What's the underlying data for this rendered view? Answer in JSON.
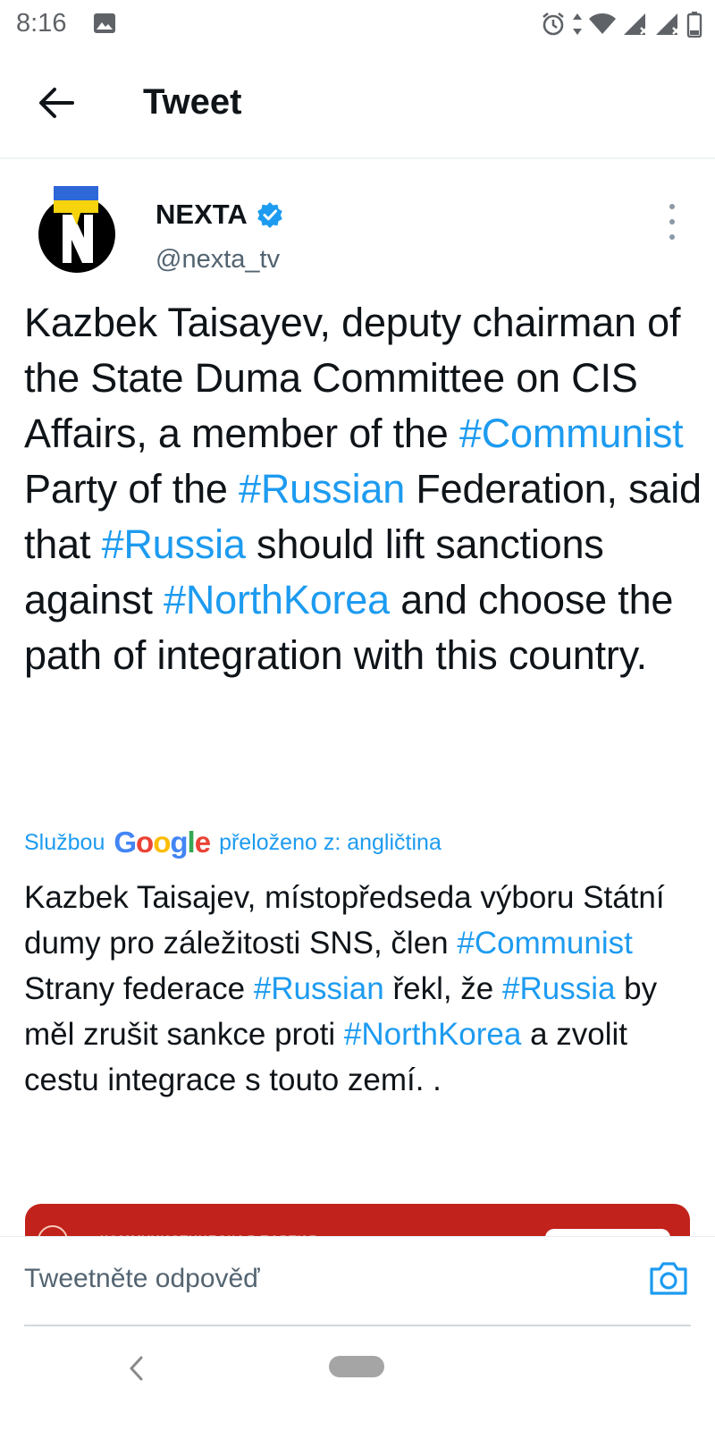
{
  "status_bar": {
    "time": "8:16"
  },
  "header": {
    "title": "Tweet"
  },
  "author": {
    "name": "NEXTA",
    "handle": "@nexta_tv",
    "avatar_letter": "N",
    "verified": true
  },
  "tweet": {
    "segments": [
      {
        "text": "Kazbek Taisayev, deputy chairman of the State Duma Committee on CIS Affairs, a member of the ",
        "hashtag": false
      },
      {
        "text": "#Communist",
        "hashtag": true
      },
      {
        "text": " Party of the ",
        "hashtag": false
      },
      {
        "text": "#Russian",
        "hashtag": true
      },
      {
        "text": " Federation, said that ",
        "hashtag": false
      },
      {
        "text": "#Russia",
        "hashtag": true
      },
      {
        "text": " should lift sanctions against ",
        "hashtag": false
      },
      {
        "text": "#NorthKorea",
        "hashtag": true
      },
      {
        "text": " and choose the path of integration with this country.",
        "hashtag": false
      }
    ]
  },
  "translation": {
    "prefix": "Službou",
    "provider": "Google",
    "suffix": "přeloženo z: angličtina",
    "segments": [
      {
        "text": "Kazbek Taisajev, místopředseda výboru Státní dumy pro záležitosti SNS, člen ",
        "hashtag": false
      },
      {
        "text": "#Communist",
        "hashtag": true
      },
      {
        "text": " Strany federace ",
        "hashtag": false
      },
      {
        "text": "#Russian",
        "hashtag": true
      },
      {
        "text": " řekl, že ",
        "hashtag": false
      },
      {
        "text": "#Russia",
        "hashtag": true
      },
      {
        "text": " by měl zrušit sankce proti ",
        "hashtag": false
      },
      {
        "text": "#NorthKorea",
        "hashtag": true
      },
      {
        "text": " a zvolit cestu integrace s touto zemí. .",
        "hashtag": false
      }
    ]
  },
  "media_card": {
    "label": "КОММУНИСТИЧЕСКАЯ ПАРТИЯ"
  },
  "reply": {
    "placeholder": "Tweetněte odpověď"
  },
  "icons": {
    "back": "arrow-left-icon",
    "verified": "verified-badge-icon",
    "more": "more-vertical-icon",
    "camera": "camera-icon",
    "alarm": "alarm-icon",
    "wifi": "wifi-icon",
    "signal": "signal-icon",
    "battery": "battery-icon",
    "image": "image-icon"
  },
  "colors": {
    "link": "#1d9bf0",
    "text": "#0f1419",
    "muted": "#536471",
    "card_red": "#c1221b"
  }
}
